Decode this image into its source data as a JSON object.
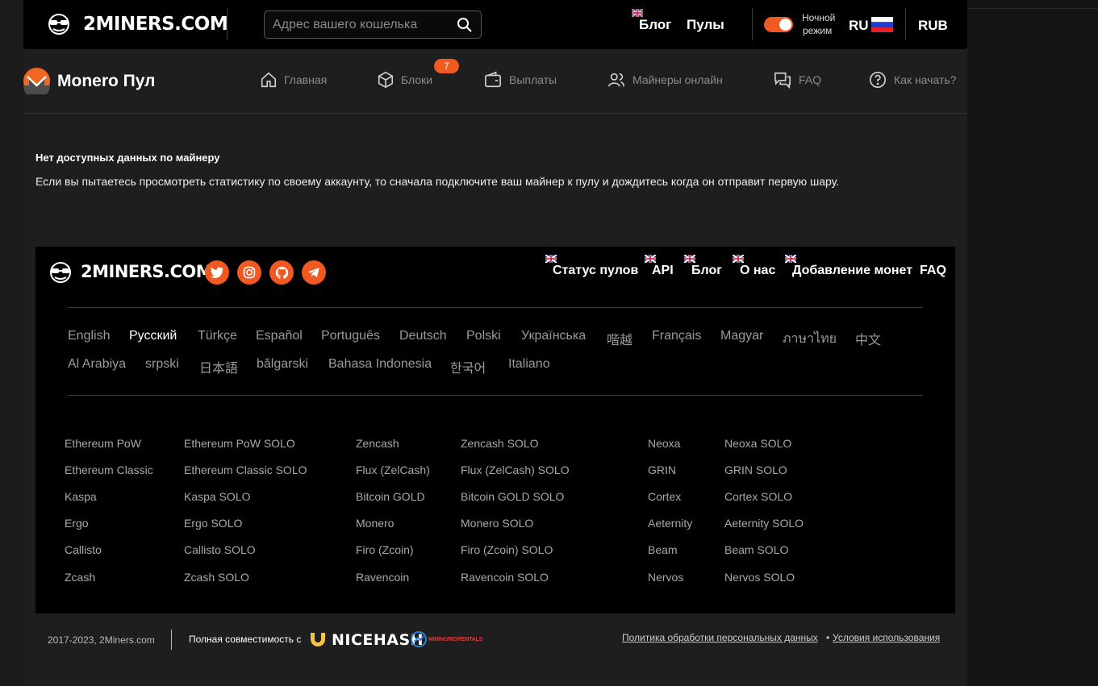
{
  "header": {
    "logo_text": "2MINERS.COM",
    "search_placeholder": "Адрес вашего кошелька",
    "blog_label": "Блог",
    "pools_label": "Пулы",
    "night_mode_line1": "Ночной",
    "night_mode_line2": "режим",
    "night_mode_on": true,
    "language": "RU",
    "currency": "RUB"
  },
  "subnav": {
    "pool_title": "Monero Пул",
    "items": [
      {
        "label": "Главная",
        "icon": "home-icon"
      },
      {
        "label": "Блоки",
        "icon": "cube-icon",
        "badge": "7"
      },
      {
        "label": "Выплаты",
        "icon": "wallet-icon"
      },
      {
        "label": "Майнеры онлайн",
        "icon": "users-icon"
      },
      {
        "label": "FAQ",
        "icon": "chat-icon"
      },
      {
        "label": "Как начать?",
        "icon": "help-circle-icon"
      }
    ]
  },
  "main": {
    "heading": "Нет доступных данных по майнеру",
    "message": "Если вы пытаетесь просмотреть статистику по своему аккаунту, то сначала подключите ваш майнер к пулу и дождитесь когда он отправит первую шару."
  },
  "footer": {
    "logo_text": "2MINERS.COM",
    "social": [
      "twitter-icon",
      "instagram-icon",
      "github-icon",
      "telegram-icon"
    ],
    "links": [
      "Статус пулов",
      "API",
      "Блог",
      "О нас",
      "Добавление монет",
      "FAQ"
    ],
    "languages_row1": [
      "English",
      "Русский",
      "Türkçe",
      "Español",
      "Português",
      "Deutsch",
      "Polski",
      "Українська",
      "喈越",
      "Français",
      "Magyar",
      "ภาษาไทย",
      "中文"
    ],
    "languages_row2": [
      "Al Arabiya",
      "srpski",
      "日本語",
      "bălgarski",
      "Bahasa Indonesia",
      "한국어",
      "Italiano"
    ],
    "active_language": "Русский",
    "pools": [
      [
        "Ethereum PoW",
        "Ethereum Classic",
        "Kaspa",
        "Ergo",
        "Callisto",
        "Zcash"
      ],
      [
        "Ethereum PoW SOLO",
        "Ethereum Classic SOLO",
        "Kaspa SOLO",
        "Ergo SOLO",
        "Callisto SOLO",
        "Zcash SOLO"
      ],
      [
        "Zencash",
        "Flux (ZelCash)",
        "Bitcoin GOLD",
        "Monero",
        "Firo (Zcoin)",
        "Ravencoin"
      ],
      [
        "Zencash SOLO",
        "Flux (ZelCash) SOLO",
        "Bitcoin GOLD SOLO",
        "Monero SOLO",
        "Firo (Zcoin) SOLO",
        "Ravencoin SOLO"
      ],
      [
        "Neoxa",
        "GRIN",
        "Cortex",
        "Aeternity",
        "Beam",
        "Nervos"
      ],
      [
        "Neoxa SOLO",
        "GRIN SOLO",
        "Cortex SOLO",
        "Aeternity SOLO",
        "Beam SOLO",
        "Nervos SOLO"
      ]
    ],
    "copyright": "2017-2023, 2Miners.com",
    "compat_label": "Полная совместимость с",
    "nicehash_text": "NICEHASH",
    "mrr_text": "MININGRIGRENTALS",
    "privacy_label": "Политика обработки персональных данных",
    "bullet": "•",
    "terms_label": "Условия использования"
  },
  "colors": {
    "accent": "#f05a22",
    "bg": "#1b1b1b",
    "panel": "#000000"
  }
}
